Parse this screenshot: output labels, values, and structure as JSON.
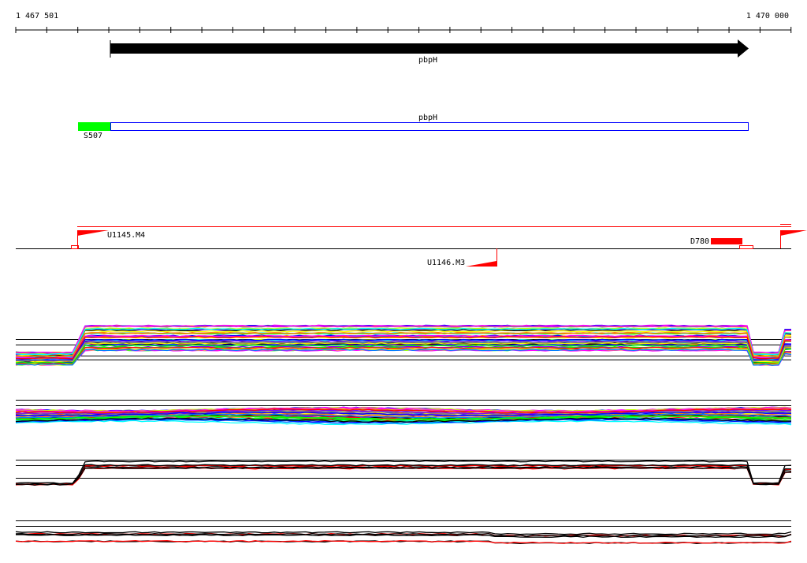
{
  "ruler": {
    "start_label": "1 467 501",
    "end_label": "1 470 000",
    "start": 1467501,
    "end": 1470000
  },
  "gene": {
    "name": "pbpH",
    "strand": "+",
    "color": "#000000"
  },
  "transcript": {
    "name": "pbpH",
    "utr_label": "S507",
    "utr_color": "#00ff00",
    "box_color": "#0000ff"
  },
  "features": {
    "upstream_flag": "U1145.M4",
    "downstream_flag": "U1146.M3",
    "d_feature": "D780",
    "color": "#ff0000"
  },
  "tracks": {
    "palette": [
      "#ff00ff",
      "#00ff00",
      "#0000ff",
      "#ff0000",
      "#00ffff",
      "#ffff00",
      "#808080",
      "#ff8000",
      "#0080ff",
      "#000000",
      "#c0ff00",
      "#8000ff"
    ]
  }
}
